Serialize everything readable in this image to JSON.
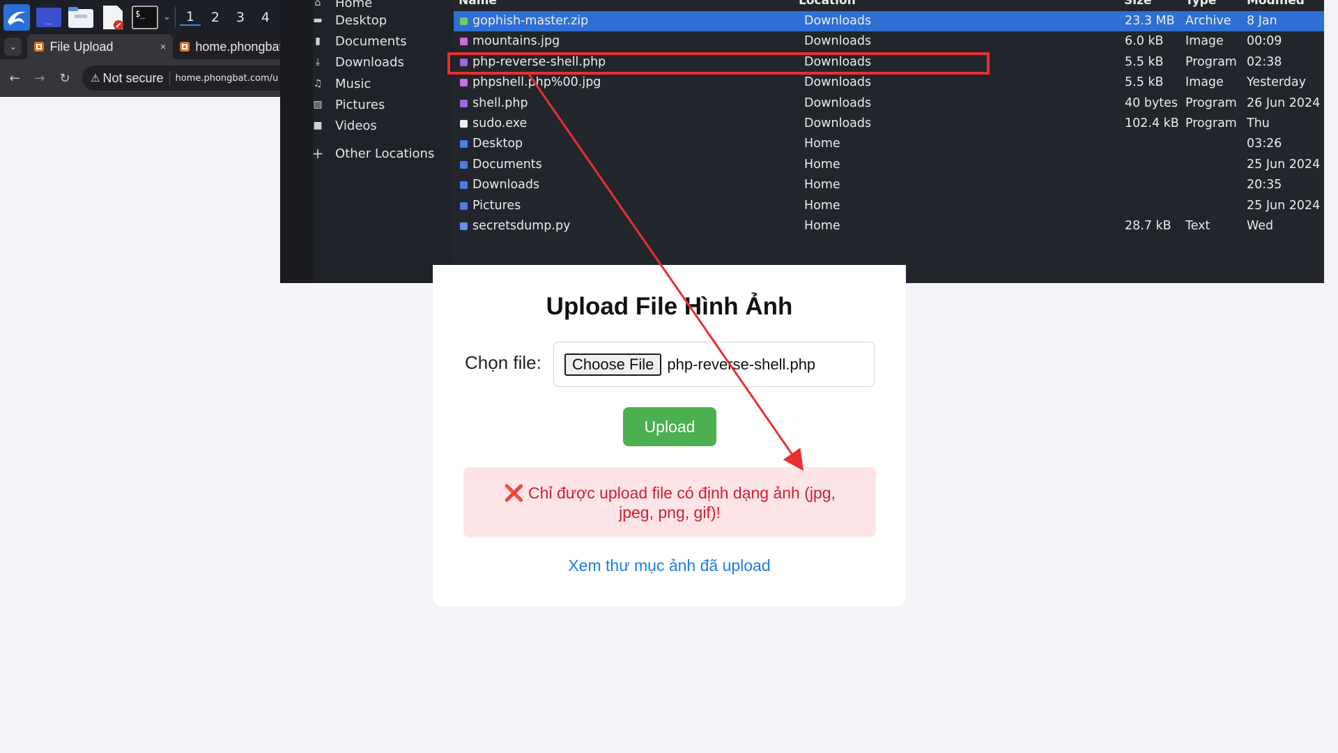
{
  "taskbar": {
    "apps": [
      "kali-menu-icon",
      "window-switcher-icon",
      "file-manager-icon",
      "text-editor-icon",
      "terminal-icon"
    ],
    "workspaces": [
      "1",
      "2",
      "3",
      "4"
    ],
    "active_workspace": "1"
  },
  "browser": {
    "tabs": [
      {
        "label": "File Upload",
        "active": true,
        "close": "×"
      },
      {
        "label": "home.phongbat",
        "active": false
      }
    ],
    "security_label": "Not secure",
    "url": "home.phongbat.com/u"
  },
  "dialog": {
    "sidebar": [
      {
        "label": "Home",
        "icon": "home-icon"
      },
      {
        "label": "Desktop",
        "icon": "desktop-icon"
      },
      {
        "label": "Documents",
        "icon": "document-icon"
      },
      {
        "label": "Downloads",
        "icon": "download-icon"
      },
      {
        "label": "Music",
        "icon": "music-icon"
      },
      {
        "label": "Pictures",
        "icon": "pictures-icon"
      },
      {
        "label": "Videos",
        "icon": "video-icon"
      },
      {
        "label": "Other Locations",
        "icon": "plus-icon"
      }
    ],
    "columns": {
      "name": "Name",
      "location": "Location",
      "size": "Size",
      "type": "Type",
      "modified": "Modified"
    },
    "files": [
      {
        "name": "gophish-master.zip",
        "location": "Downloads",
        "size": "23.3 MB",
        "type": "Archive",
        "modified": "8 Jan",
        "icon": "archive-icon",
        "selected": true
      },
      {
        "name": "mountains.jpg",
        "location": "Downloads",
        "size": "6.0 kB",
        "type": "Image",
        "modified": "00:09",
        "icon": "image-icon"
      },
      {
        "name": "php-reverse-shell.php",
        "location": "Downloads",
        "size": "5.5 kB",
        "type": "Program",
        "modified": "02:38",
        "icon": "php-icon"
      },
      {
        "name": "phpshell.php%00.jpg",
        "location": "Downloads",
        "size": "5.5 kB",
        "type": "Image",
        "modified": "Yesterday",
        "icon": "image-icon"
      },
      {
        "name": "shell.php",
        "location": "Downloads",
        "size": "40 bytes",
        "type": "Program",
        "modified": "26 Jun 2024",
        "icon": "php-icon"
      },
      {
        "name": "sudo.exe",
        "location": "Downloads",
        "size": "102.4 kB",
        "type": "Program",
        "modified": "Thu",
        "icon": "exe-icon"
      },
      {
        "name": "Desktop",
        "location": "Home",
        "size": "",
        "type": "",
        "modified": "03:26",
        "icon": "folder-icon"
      },
      {
        "name": "Documents",
        "location": "Home",
        "size": "",
        "type": "",
        "modified": "25 Jun 2024",
        "icon": "folder-icon"
      },
      {
        "name": "Downloads",
        "location": "Home",
        "size": "",
        "type": "",
        "modified": "20:35",
        "icon": "folder-icon"
      },
      {
        "name": "Pictures",
        "location": "Home",
        "size": "",
        "type": "",
        "modified": "25 Jun 2024",
        "icon": "folder-icon"
      },
      {
        "name": "secretsdump.py",
        "location": "Home",
        "size": "28.7 kB",
        "type": "Text",
        "modified": "Wed",
        "icon": "python-icon"
      }
    ]
  },
  "upload_page": {
    "title": "Upload File Hình Ảnh",
    "choose_label": "Chọn file:",
    "choose_button": "Choose File",
    "chosen_file": "php-reverse-shell.php",
    "upload_button": "Upload",
    "error_icon": "❌",
    "error_message": "Chỉ được upload file có định dạng ảnh (jpg, jpeg, png, gif)!",
    "view_link": "Xem thư mục ảnh đã upload"
  },
  "colors": {
    "annotation": "#e8302e",
    "selection": "#2f6fd4",
    "upload_button": "#4caf50",
    "error_text": "#cc2233",
    "link": "#1a7ee8"
  }
}
